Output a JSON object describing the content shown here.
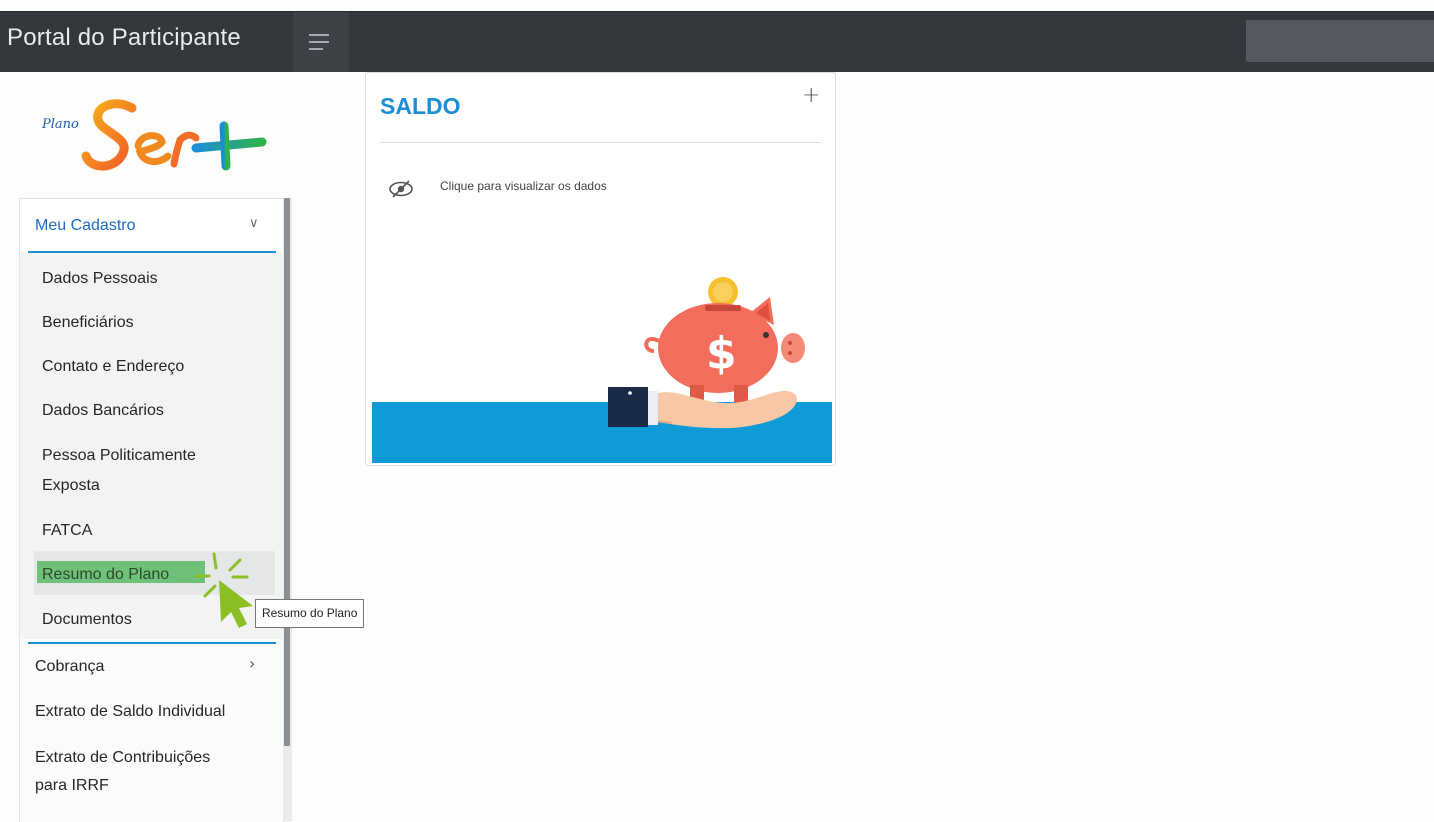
{
  "header": {
    "app_title": "Portal do Participante",
    "menu_icon": "hamburger-icon"
  },
  "logo": {
    "prefix": "Plano",
    "name": "Ser+"
  },
  "sidebar": {
    "section": {
      "label": "Meu Cadastro",
      "expanded": true,
      "items": [
        "Dados Pessoais",
        "Beneficiários",
        "Contato e Endereço",
        "Dados Bancários",
        "Pessoa Politicamente",
        "Exposta",
        "FATCA",
        "Resumo do Plano",
        "Documentos"
      ]
    },
    "cobranca": "Cobrança",
    "extrato_saldo": "Extrato de Saldo Individual",
    "extrato_contrib_1": "Extrato de Contribuições",
    "extrato_contrib_2": "para IRRF"
  },
  "tooltip": "Resumo do Plano",
  "card": {
    "title": "SALDO",
    "expand_symbol": "+",
    "hint": "Clique para visualizar os dados",
    "dollar": "$"
  },
  "colors": {
    "accent": "#1a8fd6",
    "topbar": "#33363b",
    "highlight": "#6fc17a",
    "cursor": "#8cbf26",
    "piggy": "#f26d5b",
    "coin": "#f6c12c"
  }
}
